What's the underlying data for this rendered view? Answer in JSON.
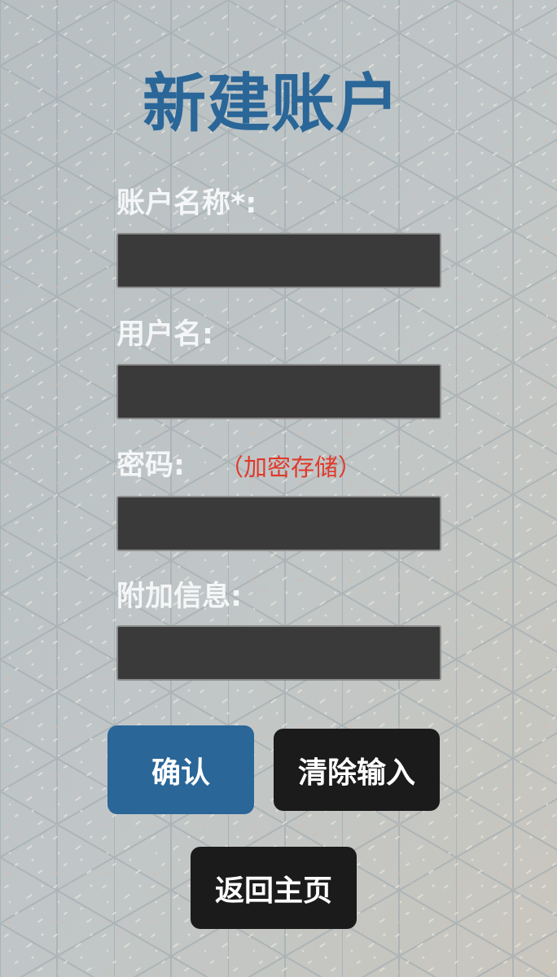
{
  "form": {
    "title": "新建账户",
    "account_name": {
      "label": "账户名称*:",
      "value": ""
    },
    "username": {
      "label": "用户名:",
      "value": ""
    },
    "password": {
      "label": "密码:",
      "note": "（加密存储）",
      "value": ""
    },
    "extra_info": {
      "label": "附加信息:",
      "value": ""
    }
  },
  "buttons": {
    "confirm": "确认",
    "clear": "清除输入",
    "home": "返回主页"
  },
  "colors": {
    "accent": "#2a6698",
    "note": "#e0392b",
    "field_bg": "#3a3a3a",
    "dark_button": "#1b1b1b",
    "background": "#b9c0c2"
  }
}
